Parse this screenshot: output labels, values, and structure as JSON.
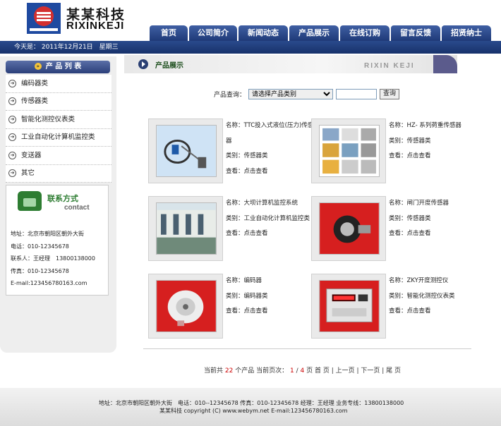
{
  "header": {
    "logo_cn": "某某科技",
    "logo_en": "RIXINKEJI",
    "nav": [
      "首页",
      "公司简介",
      "新闻动态",
      "产品展示",
      "在线订购",
      "留言反馈",
      "招贤纳士"
    ]
  },
  "datebar": {
    "text": "今天是： 2011年12月21日　星期三"
  },
  "sidebar": {
    "title": "产 品 列 表",
    "items": [
      "编码器类",
      "传感器类",
      "智能化测控仪表类",
      "工业自动化计算机监控类",
      "变送器",
      "其它"
    ],
    "contact": {
      "title_cn": "联系方式",
      "title_en": "contact",
      "address": "地址：北京市朝阳区朝外大街",
      "phone": "电话：010-12345678",
      "person": "联系人：王经理　13800138000",
      "fax": "传真：010-12345678",
      "email": "E-mail:123456780163.com"
    }
  },
  "main": {
    "section_title": "产品展示",
    "brand": "RIXIN KEJI",
    "query_label": "产品查询：",
    "select_value": "请选择产品类别",
    "search_button": "查询",
    "view_link": "点击查看",
    "products": [
      {
        "name": "名称：TTC投入式液位(压力)传感器",
        "category": "类别：传感器类",
        "view": "查看：点击查看"
      },
      {
        "name": "名称：HZ- 系列荷重传感器",
        "category": "类别：传感器类",
        "view": "查看：点击查看"
      },
      {
        "name": "名称：大坝计算机监控系统",
        "category": "类别：工业自动化计算机监控类",
        "view": "查看：点击查看"
      },
      {
        "name": "名称：闸门开度传感器",
        "category": "类别：传感器类",
        "view": "查看：点击查看"
      },
      {
        "name": "名称：编码器",
        "category": "类别：编码器类",
        "view": "查看：点击查看"
      },
      {
        "name": "名称：ZKY开度测控仪",
        "category": "类别：智能化测控仪表类",
        "view": "查看：点击查看"
      }
    ],
    "pager": {
      "prefix": "当前共",
      "total": "22",
      "suffix1": "个产品 当前页次：",
      "current": "1",
      "slash": "/",
      "pages": "4",
      "suffix2": "页 首 页 | 上一页 | 下一页 | 尾 页"
    }
  },
  "footer": {
    "line1": "地址：北京市朝阳区朝外大街　电话：010--12345678 传真：010-12345678 经理：王经理 业务专线：13800138000",
    "line2": "某某科技 copyright (C) www.webym.net E-mail:123456780163.com"
  },
  "colors": {
    "nav": "#1f3a78",
    "accent_red": "#cc0000",
    "contact_green": "#2e7d32"
  }
}
